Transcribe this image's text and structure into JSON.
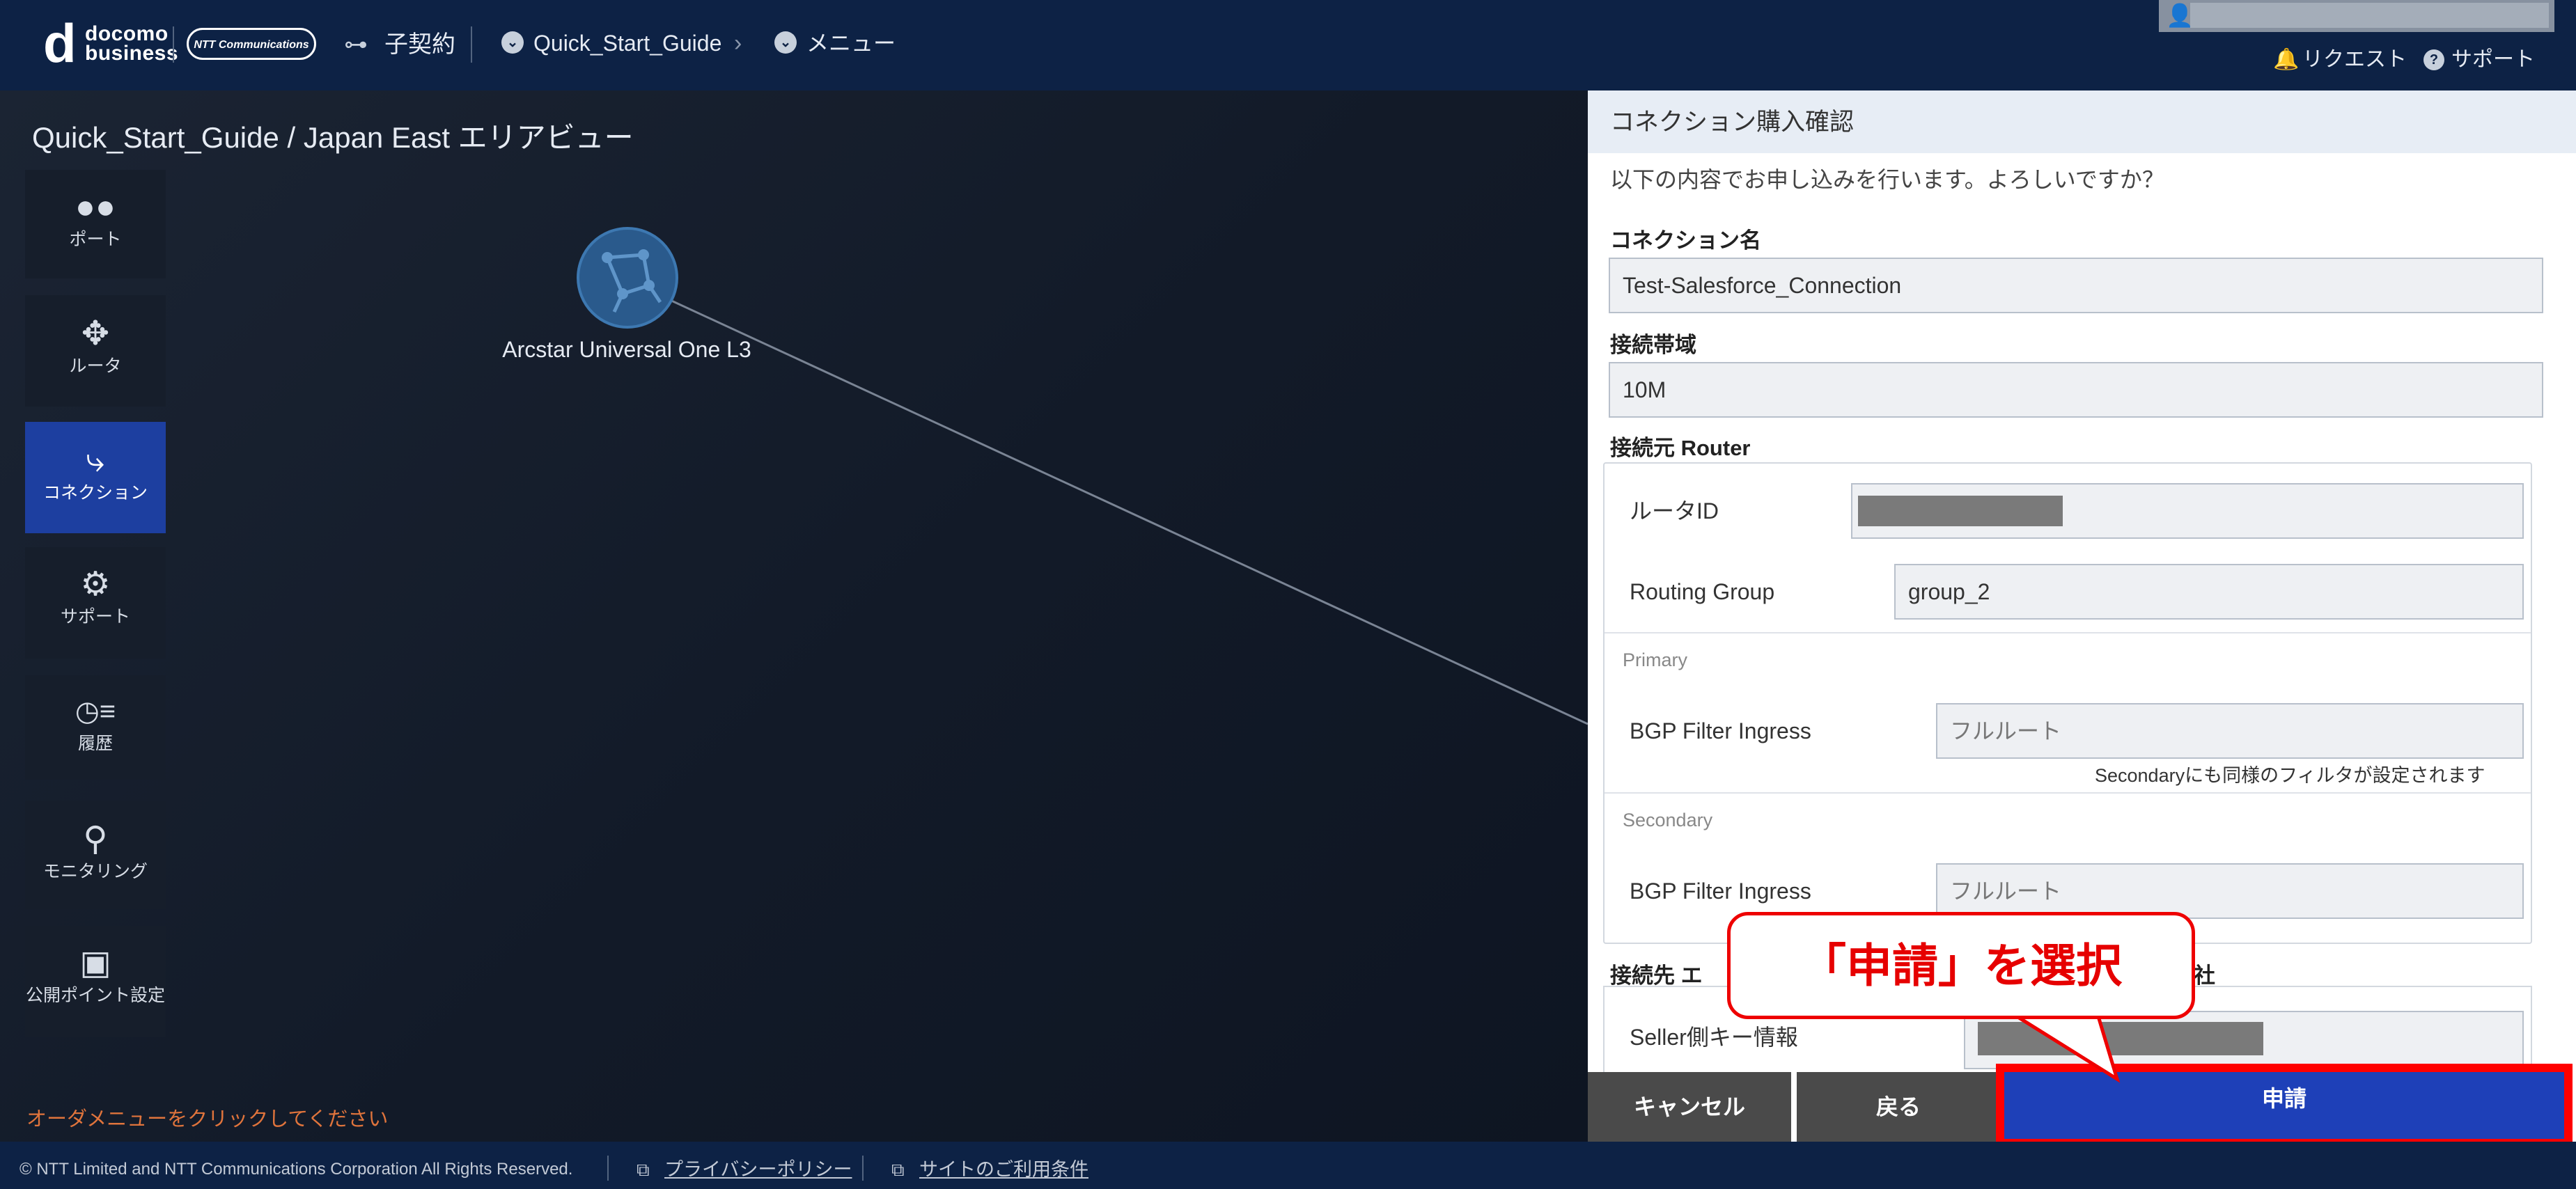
{
  "header": {
    "brand_docomo": "docomo",
    "brand_business": "business",
    "brand_ntt": "NTT Communications",
    "contract_label": "子契約",
    "breadcrumb_1": "Quick_Start_Guide",
    "breadcrumb_2": "メニュー",
    "request_label": "リクエスト",
    "support_label": "サポート"
  },
  "canvas": {
    "title": "Quick_Start_Guide / Japan East エリアビュー",
    "node_label": "Arcstar Universal One L3",
    "order_hint": "オーダメニューをクリックしてください"
  },
  "sidebar": {
    "items": [
      {
        "label": "ポート",
        "icon": "port-icon"
      },
      {
        "label": "ルータ",
        "icon": "router-icon"
      },
      {
        "label": "コネクション",
        "icon": "connection-icon"
      },
      {
        "label": "サポート",
        "icon": "support-icon"
      },
      {
        "label": "履歴",
        "icon": "history-icon"
      },
      {
        "label": "モニタリング",
        "icon": "monitoring-icon"
      },
      {
        "label": "公開ポイント設定",
        "icon": "public-point-icon"
      }
    ],
    "active": "コネクション"
  },
  "panel": {
    "title": "コネクション購入確認",
    "message": "以下の内容でお申し込みを行います。よろしいですか？",
    "connection_name_label": "コネクション名",
    "connection_name_value": "Test-Salesforce_Connection",
    "bandwidth_label": "接続帯域",
    "bandwidth_value": "10M",
    "source_router_label": "接続元 Router",
    "router_id_label": "ルータID",
    "routing_group_label": "Routing Group",
    "routing_group_value": "group_2",
    "primary_label": "Primary",
    "bgp_filter_label": "BGP Filter Ingress",
    "bgp_filter_value": "フルルート",
    "secondary_note": "Secondaryにも同様のフィルタが設定されます",
    "secondary_label": "Secondary",
    "dest_label_start": "接続先 エ",
    "dest_label_end": "社",
    "seller_key_label": "Seller側キー情報"
  },
  "buttons": {
    "cancel": "キャンセル",
    "back": "戻る",
    "apply": "申請"
  },
  "callout": "「申請」を選択",
  "footer": {
    "copyright": "© NTT Limited and NTT Communications Corporation All Rights Reserved.",
    "privacy": "プライバシーポリシー",
    "terms": "サイトのご利用条件"
  },
  "colors": {
    "header_bg": "#0d2245",
    "active_nav": "#1d3fa0",
    "apply_button": "#1e40b8",
    "highlight": "#ff0000",
    "hint_text": "#e0743c"
  }
}
